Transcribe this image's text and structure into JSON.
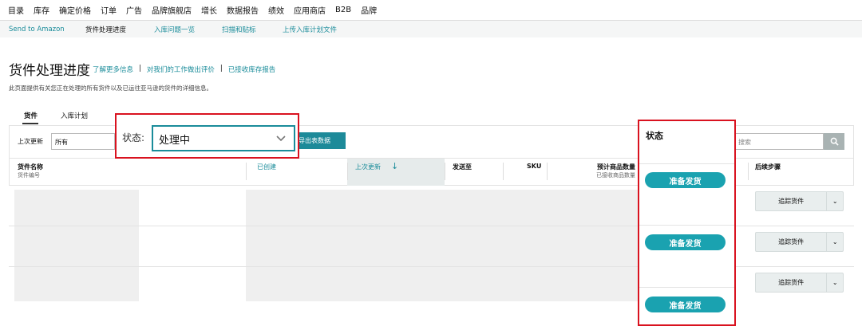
{
  "top_nav": [
    "目录",
    "库存",
    "确定价格",
    "订单",
    "广告",
    "品牌旗舰店",
    "增长",
    "数据报告",
    "绩效",
    "应用商店",
    "B2B",
    "品牌"
  ],
  "sub_nav": [
    "Send to Amazon",
    "货件处理进度",
    "入库问题一览",
    "扫描和贴标",
    "上传入库计划文件"
  ],
  "page": {
    "title": "货件处理进度",
    "links": [
      "了解更多信息",
      "对我们的工作做出评价",
      "已接收库存报告"
    ],
    "separator": "|",
    "description": "此页面提供有关您正在处理的所有货件以及已运往亚马逊的货件的详细信息。"
  },
  "tabs": [
    "货件",
    "入库计划"
  ],
  "filters": {
    "last_update_label": "上次更新",
    "last_update_value": "所有",
    "status_label": "状态:",
    "status_value": "处理中",
    "export_label": "导出表数据",
    "search_placeholder": "搜索"
  },
  "columns": {
    "name": "货件名称",
    "name_sub": "货件编号",
    "created": "已创建",
    "updated": "上次更新",
    "ship_to": "发送至",
    "sku": "SKU",
    "qty": "预计商品数量",
    "qty_sub": "已接收商品数量",
    "status": "状态",
    "next": "后续步骤"
  },
  "rows": [
    {
      "status": "准备发货",
      "action": "追踪货件"
    },
    {
      "status": "准备发货",
      "action": "追踪货件"
    },
    {
      "status": "准备发货",
      "action": "追踪货件"
    }
  ],
  "colors": {
    "accent": "#1a8c9a",
    "pill": "#1aa2b0",
    "highlight": "#d9121f"
  }
}
